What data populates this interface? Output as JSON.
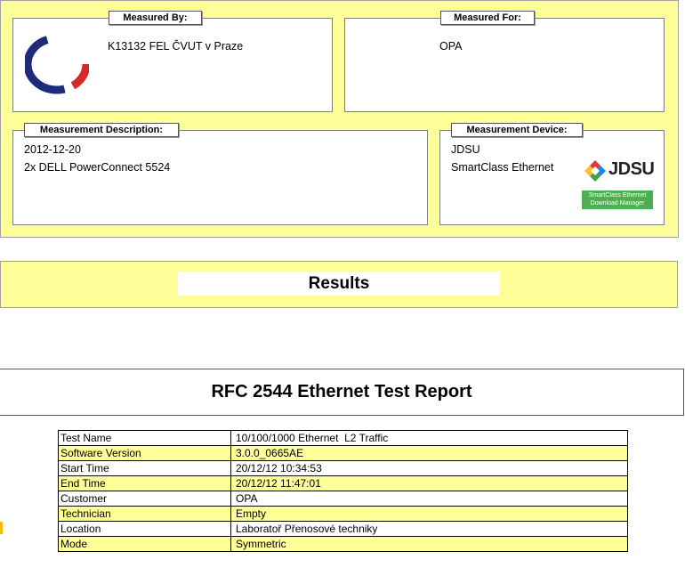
{
  "measured_by": {
    "title": "Measured By:",
    "organization": "K13132 FEL ČVUT v Praze",
    "logo": "ctu-logo-icon"
  },
  "measured_for": {
    "title": "Measured For:",
    "customer": "OPA"
  },
  "description": {
    "title": "Measurement Description:",
    "line1": "2012-12-20",
    "line2": "2x DELL PowerConnect 5524"
  },
  "device": {
    "title": "Measurement Device:",
    "vendor": "JDSU",
    "product": "SmartClass Ethernet",
    "logo_text": "JDSU",
    "badge_line1": "SmartClass Ethernet",
    "badge_line2": "Download Manager"
  },
  "results": {
    "label": "Results"
  },
  "report": {
    "title": "RFC 2544 Ethernet Test Report"
  },
  "info_table": [
    {
      "key": "Test Name",
      "value": "10/100/1000 Ethernet  L2 Traffic"
    },
    {
      "key": "Software Version",
      "value": "3.0.0_0665AE"
    },
    {
      "key": "Start Time",
      "value": "20/12/12 10:34:53"
    },
    {
      "key": "End Time",
      "value": "20/12/12 11:47:01"
    },
    {
      "key": "Customer",
      "value": "OPA"
    },
    {
      "key": "Technician",
      "value": "Empty"
    },
    {
      "key": "Location",
      "value": "Laboratoř Přenosové techniky"
    },
    {
      "key": "Mode",
      "value": "Symmetric"
    }
  ],
  "colors": {
    "highlight": "#ffff99",
    "jdsu_badge": "#4caf50"
  }
}
